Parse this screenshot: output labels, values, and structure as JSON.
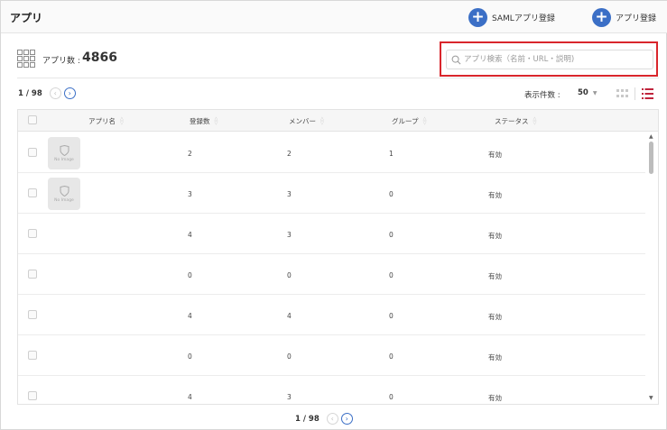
{
  "header": {
    "title": "アプリ",
    "saml_button_label": "SAMLアプリ登録",
    "app_button_label": "アプリ登録"
  },
  "summary": {
    "count_label": "アプリ数 :",
    "count_value": "4866"
  },
  "search": {
    "placeholder": "アプリ検索（名前・URL・説明)",
    "value": ""
  },
  "pagination": {
    "text": "1 / 98",
    "prev_icon": "chevron-left-icon",
    "next_icon": "chevron-right-icon"
  },
  "per_page": {
    "label": "表示件数 :",
    "value": "50"
  },
  "table": {
    "columns": [
      "アプリ名",
      "登録数",
      "メンバー",
      "グループ",
      "ステータス"
    ],
    "no_image_text": "No Image",
    "rows": [
      {
        "has_image": true,
        "registrations": "2",
        "members": "2",
        "groups": "1",
        "status": "有効"
      },
      {
        "has_image": true,
        "registrations": "3",
        "members": "3",
        "groups": "0",
        "status": "有効"
      },
      {
        "has_image": false,
        "registrations": "4",
        "members": "3",
        "groups": "0",
        "status": "有効"
      },
      {
        "has_image": false,
        "registrations": "0",
        "members": "0",
        "groups": "0",
        "status": "有効"
      },
      {
        "has_image": false,
        "registrations": "4",
        "members": "4",
        "groups": "0",
        "status": "有効"
      },
      {
        "has_image": false,
        "registrations": "0",
        "members": "0",
        "groups": "0",
        "status": "有効"
      },
      {
        "has_image": false,
        "registrations": "4",
        "members": "3",
        "groups": "0",
        "status": "有効"
      }
    ]
  },
  "colors": {
    "accent": "#3b6fc6",
    "highlight": "#d9262c",
    "list_view_icon": "#c0243c"
  }
}
